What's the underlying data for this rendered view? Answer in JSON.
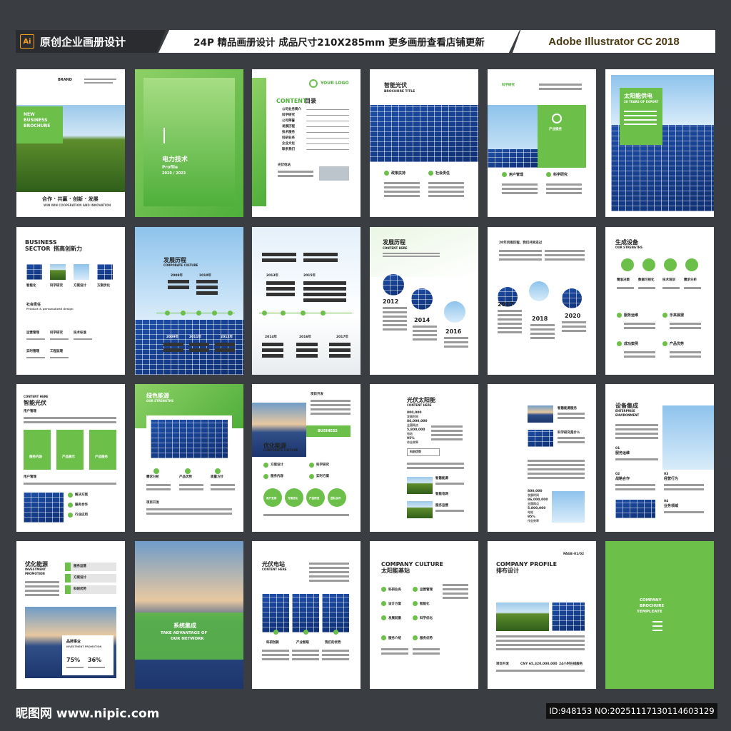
{
  "header": {
    "badge": "Ai",
    "title": "原创企业画册设计",
    "specs": "24P 精品画册设计 成品尺寸210X285mm 更多画册查看店铺更新",
    "software": "Adobe Illustrator CC 2018"
  },
  "pages": {
    "p1": {
      "brand": "BRAND",
      "headline1": "NEW",
      "headline2": "BUSINESS",
      "headline3": "BROCHURE",
      "slogan": "合作 · 共赢 · 创新 · 发展",
      "sub": "WIN WIN COOPERATION AND INNOVATION"
    },
    "p2": {
      "title": "电力技术",
      "sub": "Profile",
      "year": "2020 / 2023"
    },
    "p3": {
      "logo": "YOUR LOGO",
      "content": "CONTENT",
      "content_cn": "目录",
      "items": [
        "公司业务简介",
        "科学研究",
        "公司荣誉",
        "发展历程",
        "技术服务",
        "科研业务",
        "企业文化",
        "联系我们"
      ],
      "footer": "光伏电站"
    },
    "p4": {
      "title": "智能光伏",
      "sub": "BROCHURE TITLE",
      "l1": "政策扶持",
      "l2": "社会责任"
    },
    "p5": {
      "logo": "科学研究",
      "tag": "产业服务",
      "l1": "用户管理",
      "l2": "科学研究"
    },
    "p6": {
      "title": "太阳能供电",
      "sub": "20 YEARS OF EXPORT"
    },
    "p7": {
      "title1": "BUSINESS",
      "title2": "SECTOR",
      "title_cn": "搭高创新力",
      "i1": "智能化",
      "i2": "科学研究",
      "i3": "方案设计",
      "i4": "方案优化",
      "section": "社会责任",
      "section_en": "Product & personalized design",
      "r1": "运营管理",
      "r2": "科学研究",
      "r3": "技术标准",
      "r4": "实时管理",
      "r5": "工程监理"
    },
    "p8": {
      "title": "发展历程",
      "sub": "CORPORATE CULTURE",
      "y1": "2008年",
      "y2": "2010年",
      "y3": "2009年",
      "y4": "2011年",
      "y5": "2012年"
    },
    "p9": {
      "y1": "2013年",
      "y2": "2015年",
      "y3": "2014年",
      "y4": "2016年",
      "y5": "2017年"
    },
    "p10": {
      "title": "发展历程",
      "sub": "CONTENT HERE",
      "y1": "2012",
      "y2": "2014",
      "y3": "2016"
    },
    "p11": {
      "title": "20年风雨历程，我们共同走过",
      "y1": "2017",
      "y2": "2018",
      "y3": "2020"
    },
    "p12": {
      "title": "生成设备",
      "sub": "OUR STRENGTHS",
      "c1": "精准决策",
      "c2": "数据可视化",
      "c3": "技术培训",
      "c4": "需求分析",
      "r1": "服务运维",
      "r2": "乐来展望",
      "r3": "成功案例",
      "r4": "产品优势"
    },
    "p13": {
      "sub": "CONTENT HERE",
      "title": "智能光伏",
      "h1": "用户管理",
      "b1": "服务内容",
      "b2": "产品展示",
      "b3": "产品服务",
      "h2": "用户管理",
      "r1": "解决方案",
      "r2": "服务合作",
      "r3": "行业应用"
    },
    "p14": {
      "title": "绿色能源",
      "sub": "OUR STRENGTHS",
      "c1": "需求分析",
      "c2": "产品优势",
      "c3": "质量方针",
      "foot": "项目开发"
    },
    "p15": {
      "head": "项目开发",
      "tag": "BUSINESS",
      "title": "优化能源",
      "sub": "CORPORATE CULTURE",
      "r1": "方案设计",
      "r2": "科学研究",
      "r3": "服务内容",
      "r4": "实时方案",
      "c1": "用户支持",
      "c2": "方案优化",
      "c3": "产品研发",
      "c4": "团队合作"
    },
    "p16": {
      "title": "光伏太阳能",
      "sub": "CONTENT HERE",
      "n1": "800,000",
      "n1l": "发展时间",
      "n2": "86,000,000",
      "n2l": "全国网点",
      "n3": "5,800,000",
      "n3l": "电站",
      "n4": "95%",
      "n4l": "作业效率",
      "tag": "科创优势",
      "r1": "智慧能源",
      "r2": "智能电网",
      "r3": "服务运营"
    },
    "p17": {
      "r1": "智慧能源服务",
      "r2": "科学研究是什么",
      "n1": "800,000",
      "n1l": "发展时间",
      "n2": "86,000,000",
      "n2l": "全国网点",
      "n3": "5,800,000",
      "n3l": "电站",
      "n4": "95%",
      "n4l": "作业效率"
    },
    "p18": {
      "title": "设备集成",
      "sub1": "ENTERPRISE",
      "sub2": "ENVIRONMENT",
      "n1": "01",
      "l1": "服务运维",
      "n2": "02",
      "l2": "战略合作",
      "n3": "03",
      "l3": "经营行为",
      "n4": "04",
      "l4": "业务领域"
    },
    "p19": {
      "title": "优化能源",
      "sub1": "INVESTMENT",
      "sub2": "PROMOTION",
      "r1": "服务运营",
      "r2": "方案设计",
      "r3": "科研优势",
      "box": "品牌事业",
      "box_sub": "INVESTMENT PROMOTION",
      "v1": "75%",
      "v2": "36%"
    },
    "p20": {
      "title": "系统集成",
      "sub1": "TAKE ADVANTAGE OF",
      "sub2": "OUR NETWORK"
    },
    "p21": {
      "title": "光伏电站",
      "sub": "CONTENT HERE",
      "c1": "科研创新",
      "c2": "产业智联",
      "c3": "我们的优势"
    },
    "p22": {
      "title1": "COMPANY CULTURE",
      "title2": "太阳能基站",
      "r1": "科研业务",
      "r2": "运营管理",
      "r3": "设计方案",
      "r4": "智能化",
      "r5": "发展前景",
      "r6": "科学优化",
      "r7": "服务介绍",
      "r8": "服务优势"
    },
    "p23": {
      "page": "PAGE-01/02",
      "title1": "COMPANY PROFILE",
      "title2": "排布设计",
      "f1": "项目开发",
      "f2": "CNY 65,320,000,000",
      "f3": "24小时在线服务"
    },
    "p24": {
      "t1": "COMPANY",
      "t2": "BROCHURE",
      "t3": "TEMPLEATE"
    }
  },
  "footer": {
    "brand": "昵图网 www.nipic.com",
    "id": "ID:948153 NO:20251117130114603129"
  }
}
